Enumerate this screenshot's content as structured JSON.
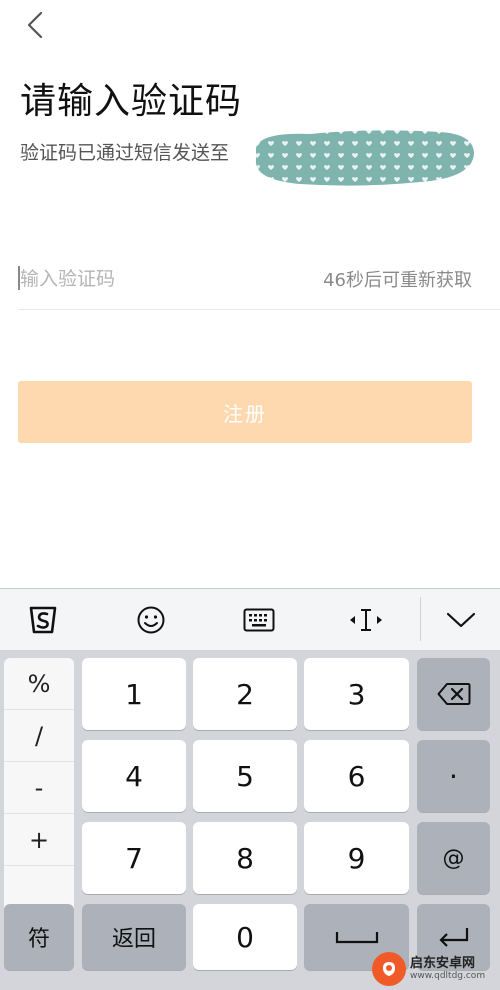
{
  "header": {
    "back_icon": "chevron-left-icon",
    "title": "请输入验证码",
    "subtitle": "验证码已通过短信发送至"
  },
  "form": {
    "code_placeholder": "输入验证码",
    "code_value": "",
    "resend_text": "46秒后可重新获取",
    "register_label": "注册"
  },
  "colors": {
    "register_bg": "#fed9b0",
    "mask_color": "#7fb3ad",
    "keyboard_bg": "#d3d5da"
  },
  "keyboard": {
    "toolbar": [
      "sogou-logo-icon",
      "emoji-icon",
      "keyboard-icon",
      "cursor-move-icon",
      "collapse-chevron-icon"
    ],
    "symbols": [
      "%",
      "/",
      "-",
      "+"
    ],
    "digits": [
      "1",
      "2",
      "3",
      "4",
      "5",
      "6",
      "7",
      "8",
      "9",
      "0"
    ],
    "dot": "·",
    "at": "@",
    "fu": "符",
    "back": "返回",
    "space_icon": "space-icon",
    "delete_icon": "backspace-icon",
    "enter_icon": "enter-icon"
  },
  "watermark": {
    "cn": "启东安卓网",
    "en": "www.qdltdg.com"
  }
}
